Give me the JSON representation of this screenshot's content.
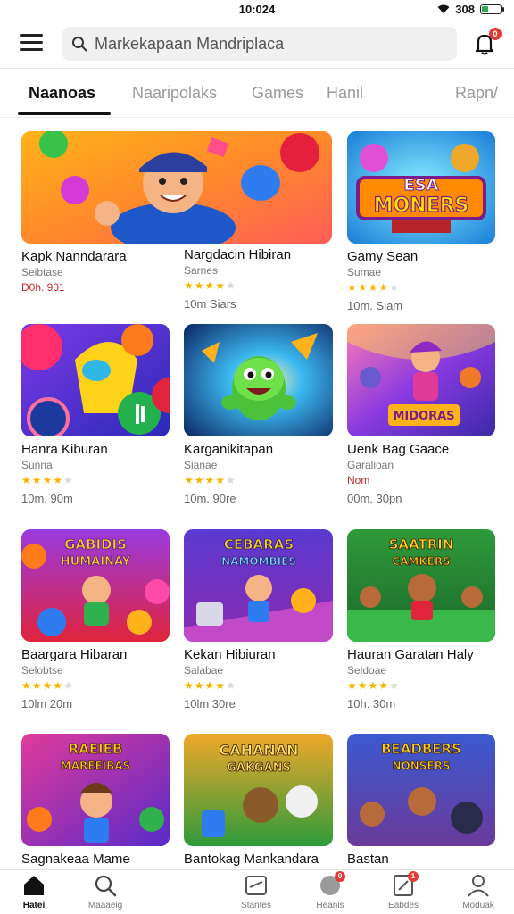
{
  "status_bar": {
    "time": "10:024",
    "battery": "308"
  },
  "search": {
    "placeholder": "Markekapaan Mandriplaca"
  },
  "notifications": {
    "badge": "0"
  },
  "tabs": [
    {
      "label": "Naanoas",
      "active": true
    },
    {
      "label": "Naaripolaks",
      "active": false
    },
    {
      "label": "Games",
      "active": false
    },
    {
      "label": "Hanil",
      "active": false
    },
    {
      "label": "Rapn/",
      "active": false
    }
  ],
  "apps": [
    {
      "title": "Kapk Nanndarara",
      "sub": "Seibtase",
      "price": "D0h. 901",
      "meta": "",
      "rating": 0
    },
    {
      "title": "Nargdacin Hibiran",
      "sub": "Sarnes",
      "price": "",
      "meta": "10m Siars",
      "rating": 4
    },
    {
      "title": "Gamy Sean",
      "sub": "Sumae",
      "price": "",
      "meta": "10m. Siam",
      "rating": 4
    },
    {
      "title": "Hanra Kiburan",
      "sub": "Sunna",
      "price": "",
      "meta": "10m. 90m",
      "rating": 4
    },
    {
      "title": "Karganikitapan",
      "sub": "Sianae",
      "price": "",
      "meta": "10m. 90re",
      "rating": 4
    },
    {
      "title": "Uenk Bag Gaace",
      "sub": "Garalioan",
      "price": "Nom",
      "meta": "00m. 30pn",
      "rating": 0
    },
    {
      "title": "Baargara Hibaran",
      "sub": "Selobtse",
      "price": "",
      "meta": "10lm 20m",
      "rating": 4
    },
    {
      "title": "Kekan Hibiuran",
      "sub": "Salabae",
      "price": "",
      "meta": "10lm 30re",
      "rating": 4
    },
    {
      "title": "Hauran Garatan Haly",
      "sub": "Seldoae",
      "price": "",
      "meta": "10h. 30m",
      "rating": 4
    },
    {
      "title": "Sagnakeaa Mame",
      "sub": "",
      "price": "",
      "meta": "",
      "rating": 0
    },
    {
      "title": "Bantokag Mankandara",
      "sub": "",
      "price": "",
      "meta": "",
      "rating": 0
    },
    {
      "title": "Bastan",
      "sub": "",
      "price": "",
      "meta": "",
      "rating": 0
    }
  ],
  "thumb_text": {
    "esa_1": "ESA",
    "esa_2": "MONERS",
    "c6": "MIDORAS",
    "c7_1": "GABIDIS",
    "c7_2": "HUMAINAY",
    "c8_1": "CEBARAS",
    "c8_2": "NAMOMBIES",
    "c9_1": "SAATRIN",
    "c9_2": "CAMKERS",
    "c10_1": "RAEIEB",
    "c10_2": "MAREEIBAS",
    "c11_1": "CAHANAN",
    "c11_2": "GAKGANS",
    "c12_1": "BEADBERS",
    "c12_2": "NONSERS"
  },
  "bottom_nav": [
    {
      "label": "Hatei",
      "icon": "home-icon",
      "active": true
    },
    {
      "label": "Maaaeig",
      "icon": "search-icon",
      "active": false
    },
    {
      "label": "Stantes",
      "icon": "games-icon",
      "active": false
    },
    {
      "label": "Heanis",
      "icon": "apps-icon",
      "active": false,
      "badge": "0"
    },
    {
      "label": "Eabdes",
      "icon": "books-icon",
      "active": false,
      "badge": "1"
    },
    {
      "label": "Moduak",
      "icon": "profile-icon",
      "active": false
    }
  ],
  "colors": {
    "accent": "#111111",
    "badge": "#e53935",
    "star": "#f5b400",
    "price": "#c62828"
  }
}
